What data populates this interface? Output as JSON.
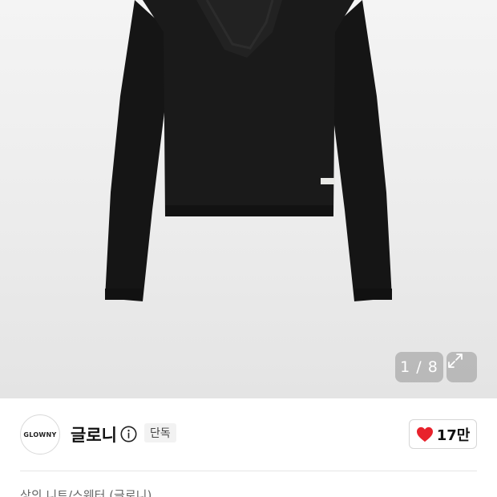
{
  "gallery": {
    "counter": "1 / 8",
    "product_image_icon": "black-knit-sweater-photo",
    "expand_icon": "expand-arrows-icon"
  },
  "brand": {
    "logo_text": "GLOWNY",
    "name": "글로니",
    "info_icon": "info-icon",
    "badge": "단독"
  },
  "like": {
    "icon": "heart-icon",
    "count": "17만",
    "heart_color": "#e8222c"
  },
  "breadcrumb": {
    "partial_text": "상의  니트/스웨터  (글로니)"
  }
}
